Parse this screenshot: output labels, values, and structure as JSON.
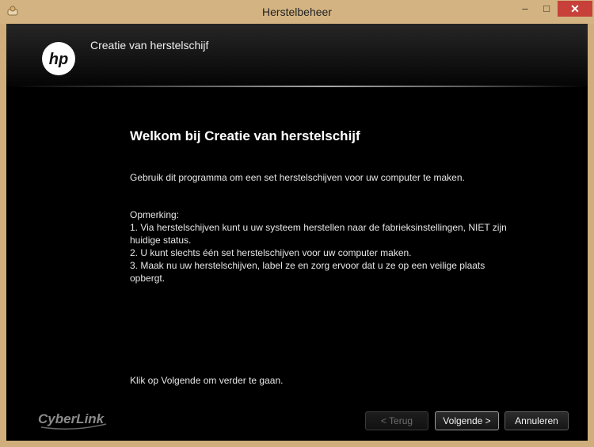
{
  "window": {
    "title": "Herstelbeheer",
    "controls": {
      "minimize": "–",
      "maximize": "□",
      "close": "✕"
    }
  },
  "header": {
    "logo_text": "hp",
    "title": "Creatie van herstelschijf"
  },
  "content": {
    "heading": "Welkom bij Creatie van herstelschijf",
    "intro": "Gebruik dit programma om een set herstelschijven voor uw computer te maken.",
    "note_label": "Opmerking:",
    "notes": [
      "1. Via herstelschijven kunt u uw systeem herstellen naar de fabrieksinstellingen, NIET zijn huidige status.",
      "2. U kunt slechts één set herstelschijven voor uw computer maken.",
      "3. Maak nu uw herstelschijven, label ze en zorg ervoor dat u ze op een veilige plaats opbergt."
    ],
    "footer": "Klik op Volgende om verder te gaan."
  },
  "brand": {
    "name": "CyberLink"
  },
  "buttons": {
    "back": "< Terug",
    "next": "Volgende >",
    "cancel": "Annuleren"
  },
  "colors": {
    "title_bar": "#d3b382",
    "client_bg": "#000000",
    "close_button": "#c7403a"
  }
}
